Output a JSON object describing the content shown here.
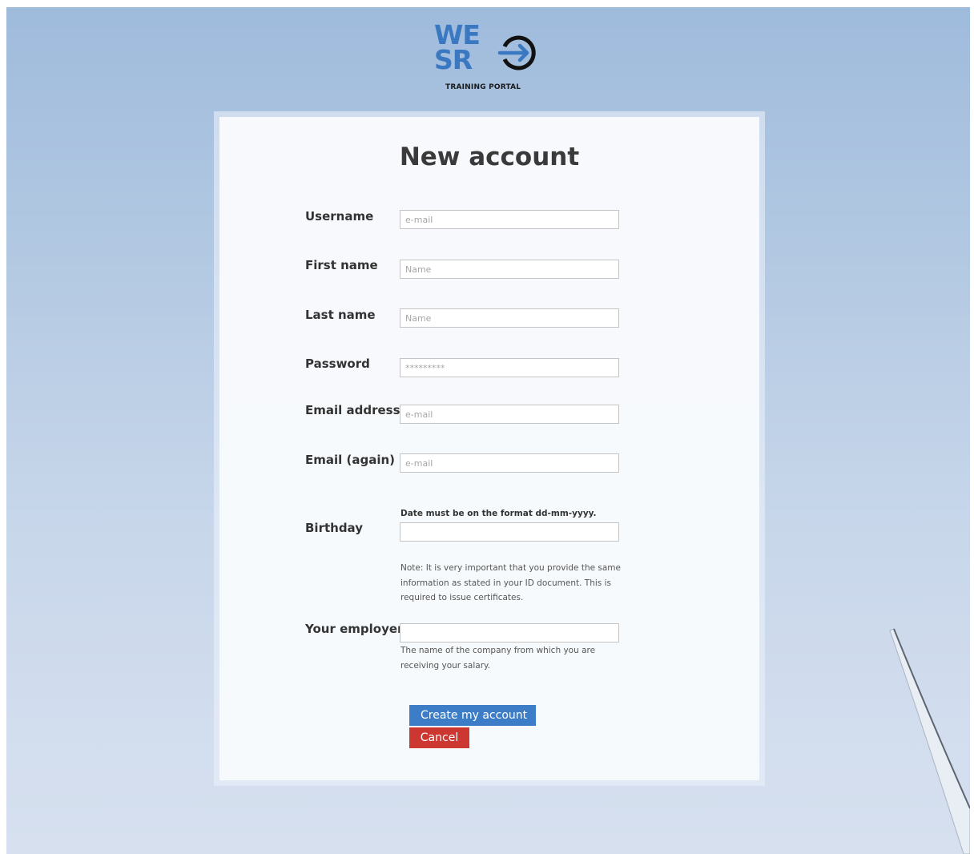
{
  "logo": {
    "line1": "WE",
    "line2": "SR",
    "subtitle": "TRAINING PORTAL",
    "icon": "arrow-right-circle-icon",
    "color": "#3b78c2"
  },
  "form": {
    "title": "New account",
    "fields": {
      "username": {
        "label": "Username",
        "placeholder": "e-mail"
      },
      "first_name": {
        "label": "First name",
        "placeholder": "Name"
      },
      "last_name": {
        "label": "Last name",
        "placeholder": "Name"
      },
      "password": {
        "label": "Password",
        "placeholder": "*********"
      },
      "email": {
        "label": "Email address",
        "placeholder": "e-mail"
      },
      "email_again": {
        "label": "Email (again)",
        "placeholder": "e-mail"
      },
      "birthday": {
        "label": "Birthday",
        "hint": "Date must be on the format dd-mm-yyyy.",
        "note": "Note: It is very important that you provide the same information as stated in your ID document. This is required to issue certificates."
      },
      "employer": {
        "label": "Your employer",
        "note": "The name of the company from which you are receiving your salary."
      }
    },
    "buttons": {
      "create": "Create my account",
      "cancel": "Cancel"
    }
  },
  "colors": {
    "primary_button": "#3d7dc7",
    "cancel_button": "#cc3731"
  }
}
